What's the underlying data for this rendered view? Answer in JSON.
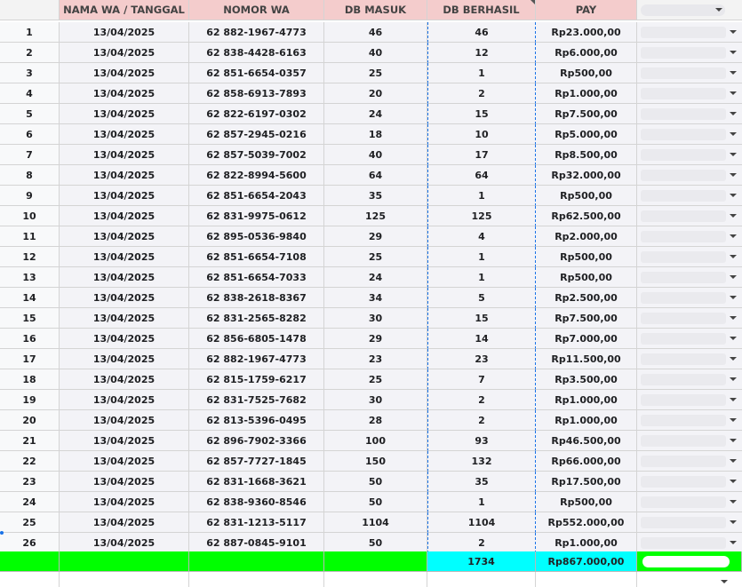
{
  "headers": [
    "",
    "NAMA WA / TANGGAL",
    "NOMOR WA",
    "DB MASUK",
    "DB BERHASIL",
    "PAY",
    ""
  ],
  "rows": [
    {
      "n": "1",
      "date": "13/04/2025",
      "phone": "62 882-1967-4773",
      "masuk": "46",
      "berhasil": "46",
      "pay": "Rp23.000,00"
    },
    {
      "n": "2",
      "date": "13/04/2025",
      "phone": "62 838-4428-6163",
      "masuk": "40",
      "berhasil": "12",
      "pay": "Rp6.000,00"
    },
    {
      "n": "3",
      "date": "13/04/2025",
      "phone": "62 851-6654-0357",
      "masuk": "25",
      "berhasil": "1",
      "pay": "Rp500,00"
    },
    {
      "n": "4",
      "date": "13/04/2025",
      "phone": "62 858-6913-7893",
      "masuk": "20",
      "berhasil": "2",
      "pay": "Rp1.000,00"
    },
    {
      "n": "5",
      "date": "13/04/2025",
      "phone": "62 822-6197-0302",
      "masuk": "24",
      "berhasil": "15",
      "pay": "Rp7.500,00"
    },
    {
      "n": "6",
      "date": "13/04/2025",
      "phone": "62 857-2945-0216",
      "masuk": "18",
      "berhasil": "10",
      "pay": "Rp5.000,00"
    },
    {
      "n": "7",
      "date": "13/04/2025",
      "phone": "62 857-5039-7002",
      "masuk": "40",
      "berhasil": "17",
      "pay": "Rp8.500,00"
    },
    {
      "n": "8",
      "date": "13/04/2025",
      "phone": "62 822-8994-5600",
      "masuk": "64",
      "berhasil": "64",
      "pay": "Rp32.000,00"
    },
    {
      "n": "9",
      "date": "13/04/2025",
      "phone": "62 851-6654-2043",
      "masuk": "35",
      "berhasil": "1",
      "pay": "Rp500,00"
    },
    {
      "n": "10",
      "date": "13/04/2025",
      "phone": "62 831-9975-0612",
      "masuk": "125",
      "berhasil": "125",
      "pay": "Rp62.500,00"
    },
    {
      "n": "11",
      "date": "13/04/2025",
      "phone": "62 895-0536-9840",
      "masuk": "29",
      "berhasil": "4",
      "pay": "Rp2.000,00"
    },
    {
      "n": "12",
      "date": "13/04/2025",
      "phone": "62 851-6654-7108",
      "masuk": "25",
      "berhasil": "1",
      "pay": "Rp500,00"
    },
    {
      "n": "13",
      "date": "13/04/2025",
      "phone": "62 851-6654-7033",
      "masuk": "24",
      "berhasil": "1",
      "pay": "Rp500,00"
    },
    {
      "n": "14",
      "date": "13/04/2025",
      "phone": "62 838-2618-8367",
      "masuk": "34",
      "berhasil": "5",
      "pay": "Rp2.500,00"
    },
    {
      "n": "15",
      "date": "13/04/2025",
      "phone": "62 831-2565-8282",
      "masuk": "30",
      "berhasil": "15",
      "pay": "Rp7.500,00"
    },
    {
      "n": "16",
      "date": "13/04/2025",
      "phone": "62 856-6805-1478",
      "masuk": "29",
      "berhasil": "14",
      "pay": "Rp7.000,00"
    },
    {
      "n": "17",
      "date": "13/04/2025",
      "phone": "62 882-1967-4773",
      "masuk": "23",
      "berhasil": "23",
      "pay": "Rp11.500,00"
    },
    {
      "n": "18",
      "date": "13/04/2025",
      "phone": "62 815-1759-6217",
      "masuk": "25",
      "berhasil": "7",
      "pay": "Rp3.500,00"
    },
    {
      "n": "19",
      "date": "13/04/2025",
      "phone": "62 831-7525-7682",
      "masuk": "30",
      "berhasil": "2",
      "pay": "Rp1.000,00"
    },
    {
      "n": "20",
      "date": "13/04/2025",
      "phone": "62 813-5396-0495",
      "masuk": "28",
      "berhasil": "2",
      "pay": "Rp1.000,00"
    },
    {
      "n": "21",
      "date": "13/04/2025",
      "phone": "62 896-7902-3366",
      "masuk": "100",
      "berhasil": "93",
      "pay": "Rp46.500,00"
    },
    {
      "n": "22",
      "date": "13/04/2025",
      "phone": "62 857-7727-1845",
      "masuk": "150",
      "berhasil": "132",
      "pay": "Rp66.000,00"
    },
    {
      "n": "23",
      "date": "13/04/2025",
      "phone": "62 831-1668-3621",
      "masuk": "50",
      "berhasil": "35",
      "pay": "Rp17.500,00"
    },
    {
      "n": "24",
      "date": "13/04/2025",
      "phone": "62 838-9360-8546",
      "masuk": "50",
      "berhasil": "1",
      "pay": "Rp500,00"
    },
    {
      "n": "25",
      "date": "13/04/2025",
      "phone": "62 831-1213-5117",
      "masuk": "1104",
      "berhasil": "1104",
      "pay": "Rp552.000,00"
    },
    {
      "n": "26",
      "date": "13/04/2025",
      "phone": "62 887-0845-9101",
      "masuk": "50",
      "berhasil": "2",
      "pay": "Rp1.000,00"
    }
  ],
  "totals": {
    "berhasil": "1734",
    "pay": "Rp867.000,00"
  },
  "colors": {
    "header": "#f4cccc",
    "total_green": "#00ff00",
    "total_cyan": "#00ffff"
  },
  "icons": {
    "dropdown": "chevron-down-icon"
  }
}
